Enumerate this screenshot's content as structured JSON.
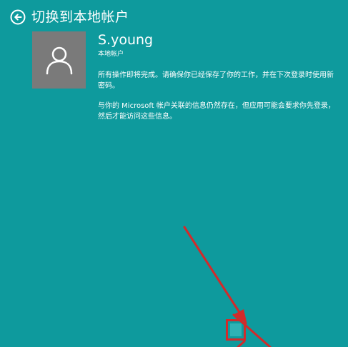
{
  "header": {
    "back_icon": "back-arrow-circle-icon",
    "title": "切换到本地帐户"
  },
  "account": {
    "avatar_icon": "user-silhouette-icon",
    "name": "S.young",
    "type": "本地帐户"
  },
  "messages": {
    "paragraph_1": "所有操作即将完成。请确保你已经保存了你的工作，并在下次登录时使用新密码。",
    "paragraph_2": "与你的 Microsoft 帐户关联的信息仍然存在，但应用可能会要求你先登录，然后才能访问这些信息。"
  },
  "footer": {
    "next_button_label": ""
  },
  "colors": {
    "background": "#0E9A9D",
    "avatar_bg": "#7A7A7A",
    "annotation_red": "#D22A2A"
  }
}
